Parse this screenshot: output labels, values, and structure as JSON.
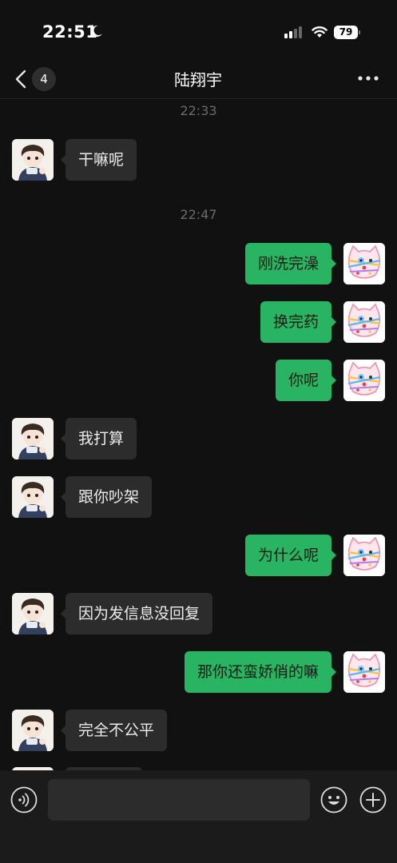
{
  "status_bar": {
    "time": "22:51",
    "battery": "79",
    "icons": [
      "moon-icon",
      "signal-icon",
      "wifi-icon",
      "battery-icon"
    ]
  },
  "nav": {
    "back_badge": "4",
    "title": "陆翔宇",
    "icons": [
      "back-chevron-icon",
      "more-dots-icon"
    ]
  },
  "chat": {
    "timestamps": [
      "22:33",
      "22:47"
    ],
    "messages": [
      {
        "side": "left",
        "text": "干嘛呢"
      },
      {
        "side": "right",
        "text": "刚洗完澡"
      },
      {
        "side": "right",
        "text": "换完药"
      },
      {
        "side": "right",
        "text": "你呢"
      },
      {
        "side": "left",
        "text": "我打算"
      },
      {
        "side": "left",
        "text": "跟你吵架"
      },
      {
        "side": "right",
        "text": "为什么呢"
      },
      {
        "side": "left",
        "text": "因为发信息没回复"
      },
      {
        "side": "right",
        "text": "那你还蛮娇俏的嘛"
      },
      {
        "side": "left",
        "text": "完全不公平"
      }
    ]
  },
  "input_bar": {
    "value": "",
    "icons": [
      "voice-icon",
      "emoji-icon",
      "plus-icon"
    ]
  },
  "colors": {
    "background": "#111111",
    "sent_bubble": "#28b462",
    "received_bubble": "#2c2c2c",
    "input_bar": "#1b1b1b"
  }
}
